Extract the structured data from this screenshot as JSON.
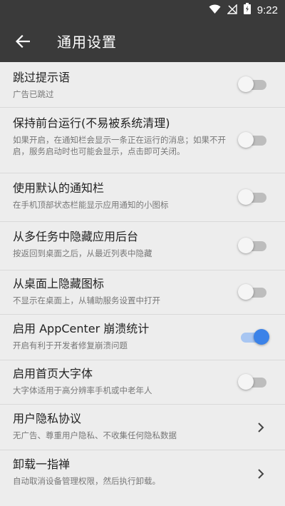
{
  "status_bar": {
    "time": "9:22"
  },
  "app_bar": {
    "title": "通用设置"
  },
  "colors": {
    "accent": "#3b82e8",
    "appbar": "#3a3a3a"
  },
  "items": [
    {
      "title": "跳过提示语",
      "subtitle": "广告已跳过",
      "control": "switch",
      "on": false
    },
    {
      "title": "保持前台运行(不易被系统清理)",
      "subtitle": "如果开启，在通知栏会显示一条正在运行的消息；如果不开启，服务启动时也可能会显示，点击即可关闭。",
      "control": "switch",
      "on": false
    },
    {
      "title": "使用默认的通知栏",
      "subtitle": "在手机顶部状态栏能显示应用通知的小图标",
      "control": "switch",
      "on": false
    },
    {
      "title": "从多任务中隐藏应用后台",
      "subtitle": "按返回到桌面之后，从最近列表中隐藏",
      "control": "switch",
      "on": false
    },
    {
      "title": "从桌面上隐藏图标",
      "subtitle": "不显示在桌面上，从辅助服务设置中打开",
      "control": "switch",
      "on": false
    },
    {
      "title": "启用 AppCenter 崩溃统计",
      "subtitle": "开启有利于开发者修复崩溃问题",
      "control": "switch",
      "on": true
    },
    {
      "title": "启用首页大字体",
      "subtitle": "大字体适用于高分辨率手机或中老年人",
      "control": "switch",
      "on": false
    },
    {
      "title": "用户隐私协议",
      "subtitle": "无广告、尊重用户隐私、不收集任何隐私数据",
      "control": "chevron"
    },
    {
      "title": "卸载一指禅",
      "subtitle": "自动取消设备管理权限，然后执行卸载。",
      "control": "chevron"
    }
  ]
}
